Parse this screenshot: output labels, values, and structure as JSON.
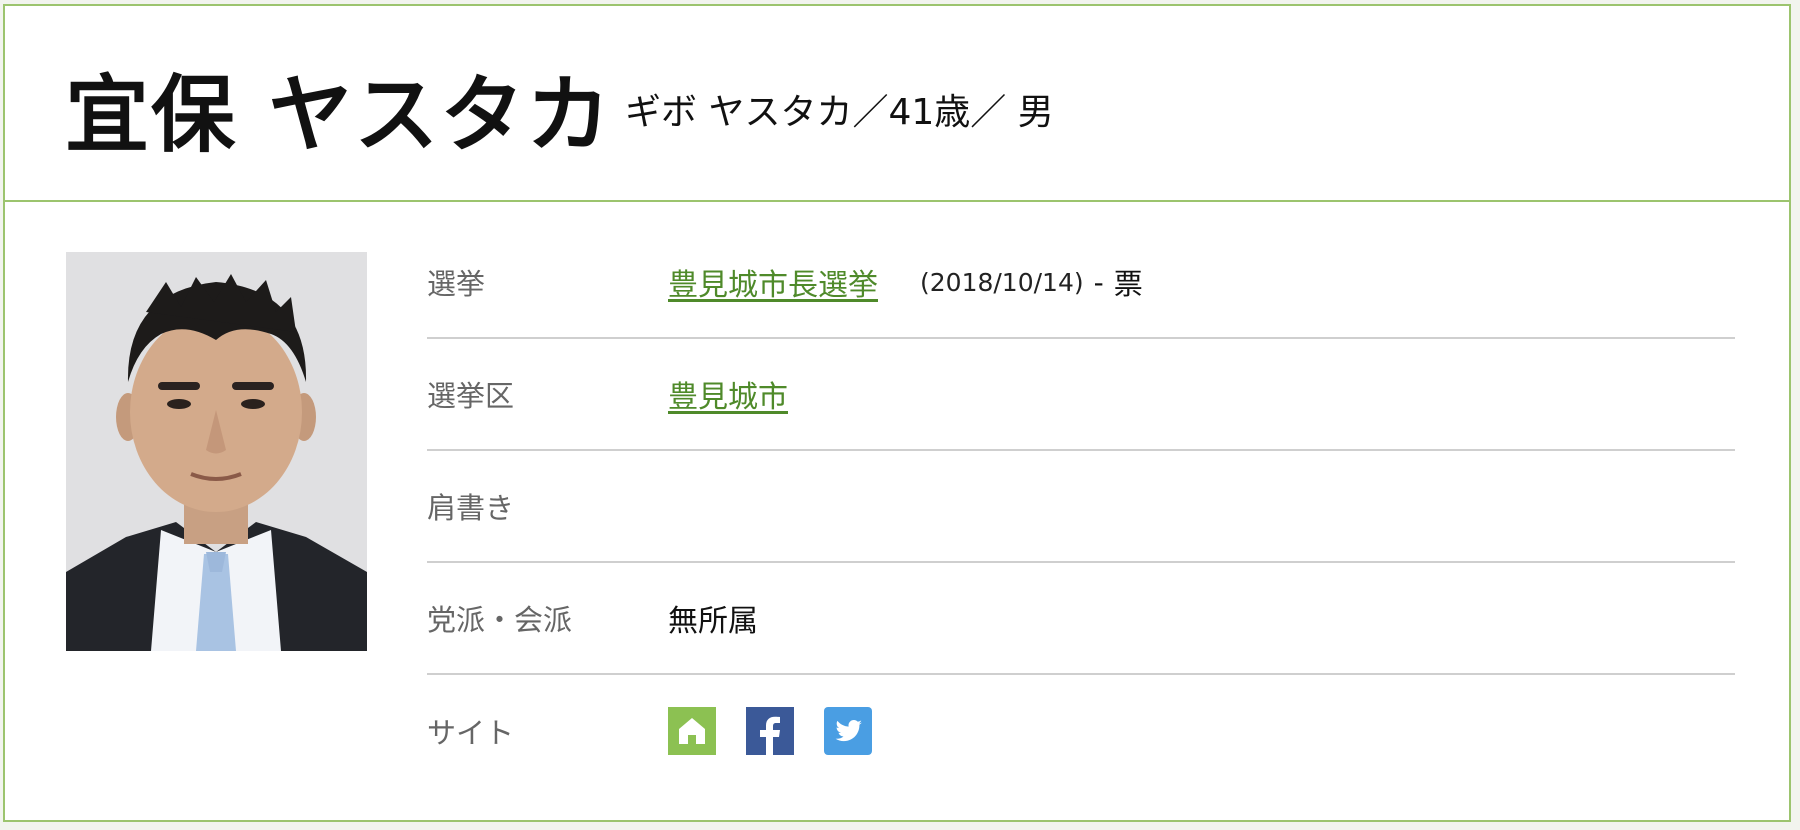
{
  "header": {
    "name": "宜保 ヤスタカ",
    "kana_age_gender": "ギボ ヤスタカ／41歳／ 男"
  },
  "profile": {
    "rows": [
      {
        "label": "選挙",
        "link": "豊見城市長選挙",
        "date": "(2018/10/14)",
        "separator": "-",
        "votes": "票"
      },
      {
        "label": "選挙区",
        "link": "豊見城市"
      },
      {
        "label": "肩書き",
        "value": ""
      },
      {
        "label": "党派・会派",
        "value": "無所属"
      },
      {
        "label": "サイト",
        "icons": [
          "home-icon",
          "facebook-icon",
          "twitter-icon"
        ]
      }
    ]
  },
  "colors": {
    "border": "#9cc46e",
    "link": "#4f8a2a",
    "home": "#8cc152",
    "facebook": "#3b5998",
    "twitter": "#4a9ee3"
  }
}
